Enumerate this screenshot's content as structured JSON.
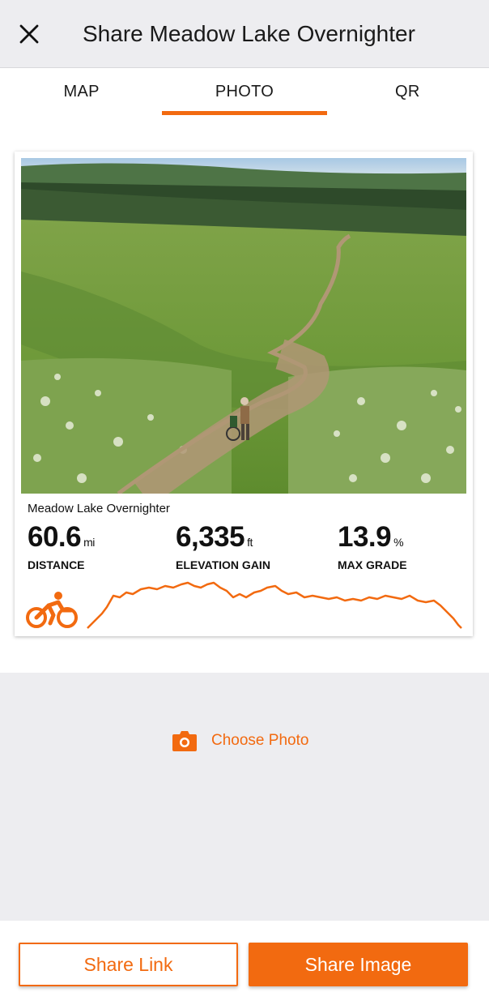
{
  "header": {
    "title": "Share Meadow Lake Overnighter",
    "close_icon": "close-icon"
  },
  "tabs": [
    {
      "label": "MAP",
      "active": false
    },
    {
      "label": "PHOTO",
      "active": true
    },
    {
      "label": "QR",
      "active": false
    }
  ],
  "card": {
    "photo_description_icon": "landscape-photo",
    "route_name": "Meadow Lake Overnighter",
    "stats": [
      {
        "value": "60.6",
        "unit": "mi",
        "label": "DISTANCE"
      },
      {
        "value": "6,335",
        "unit": "ft",
        "label": "ELEVATION GAIN"
      },
      {
        "value": "13.9",
        "unit": "%",
        "label": "MAX GRADE"
      }
    ],
    "activity_icon": "cyclist-icon"
  },
  "choose_photo": {
    "label": "Choose Photo",
    "icon": "camera-icon"
  },
  "footer": {
    "share_link_label": "Share Link",
    "share_image_label": "Share Image"
  },
  "colors": {
    "accent": "#f26a10",
    "background": "#ededf0"
  }
}
